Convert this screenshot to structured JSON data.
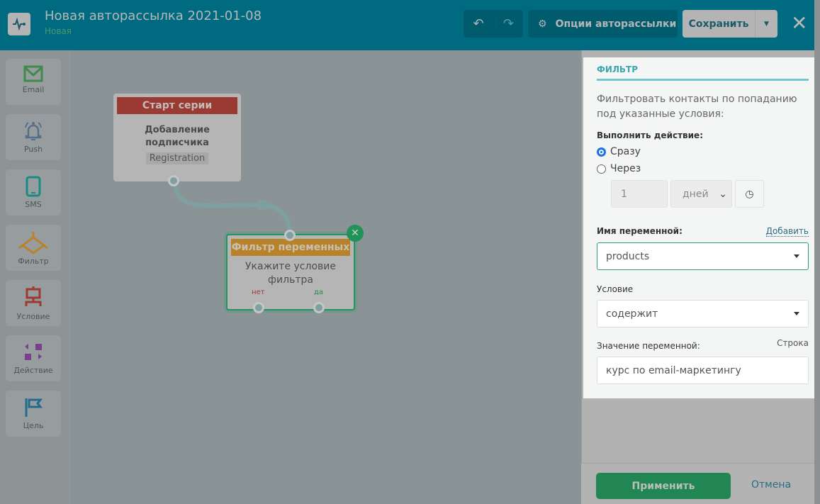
{
  "header": {
    "title": "Новая авторассылка 2021-01-08",
    "status": "Новая",
    "options_label": "Опции авторассылки",
    "save_label": "Сохранить"
  },
  "sidebar": {
    "items": [
      {
        "label": "Email",
        "icon": "email-icon",
        "color": "#3f8a4a"
      },
      {
        "label": "Push",
        "icon": "bell-icon",
        "color": "#56708a"
      },
      {
        "label": "SMS",
        "icon": "phone-icon",
        "color": "#188a84"
      },
      {
        "label": "Фильтр",
        "icon": "filter-icon",
        "color": "#b8822a"
      },
      {
        "label": "Условие",
        "icon": "condition-icon",
        "color": "#9a3a33"
      },
      {
        "label": "Действие",
        "icon": "action-icon",
        "color": "#7a3f90"
      },
      {
        "label": "Цель",
        "icon": "flag-icon",
        "color": "#246a90"
      }
    ]
  },
  "canvas": {
    "start_node": {
      "header": "Старт серии",
      "title": "Добавление подписчика",
      "tag": "Registration"
    },
    "filter_node": {
      "header": "Фильтр переменных",
      "body": "Укажите условие фильтра",
      "no_label": "нет",
      "yes_label": "да"
    }
  },
  "panel": {
    "title": "ФИЛЬТР",
    "description": "Фильтровать контакты по попаданию под указанные условия:",
    "action_label": "Выполнить действие:",
    "option_now": "Сразу",
    "option_after": "Через",
    "delay_value": "1",
    "delay_unit": "дней",
    "var_name_label": "Имя переменной:",
    "add_link": "Добавить",
    "var_name_value": "products",
    "condition_label": "Условие",
    "condition_value": "содержит",
    "var_value_label": "Значение переменной:",
    "var_type": "Строка",
    "var_value": "курс по email-маркетингу"
  },
  "footer": {
    "apply": "Применить",
    "cancel": "Отмена"
  }
}
